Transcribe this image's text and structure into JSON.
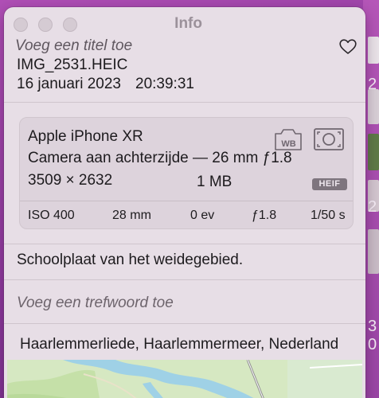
{
  "window": {
    "title": "Info"
  },
  "photo": {
    "title_placeholder": "Voeg een titel toe",
    "filename": "IMG_2531.HEIC",
    "date": "16 januari 2023",
    "time": "20:39:31"
  },
  "exif": {
    "camera_model": "Apple iPhone XR",
    "lens": "Camera aan achterzijde — 26 mm ƒ1.8",
    "dimensions": "3509 × 2632",
    "file_size": "1 MB",
    "format_badge": "HEIF",
    "white_balance_label": "WB",
    "stats": {
      "iso": "ISO 400",
      "focal_length": "28 mm",
      "exposure_bias": "0 ev",
      "aperture": "ƒ1.8",
      "shutter": "1/50 s"
    }
  },
  "caption": "Schoolplaat van het weidegebied.",
  "keyword_placeholder": "Voeg een trefwoord toe",
  "location": "Haarlemmerliede, Haarlemmermeer, Nederland",
  "background_glyphs": [
    "2",
    "2",
    "3",
    "0"
  ],
  "icons": {
    "favorite": "heart-icon",
    "white_balance": "wb-icon",
    "metering": "metering-icon"
  },
  "colors": {
    "desktop": "#a245ad",
    "window": "#e7dee6",
    "card": "#ddd3dc",
    "badge": "#7e757e",
    "map_land": "#d6e8c2",
    "map_water": "#9fd1e6"
  }
}
